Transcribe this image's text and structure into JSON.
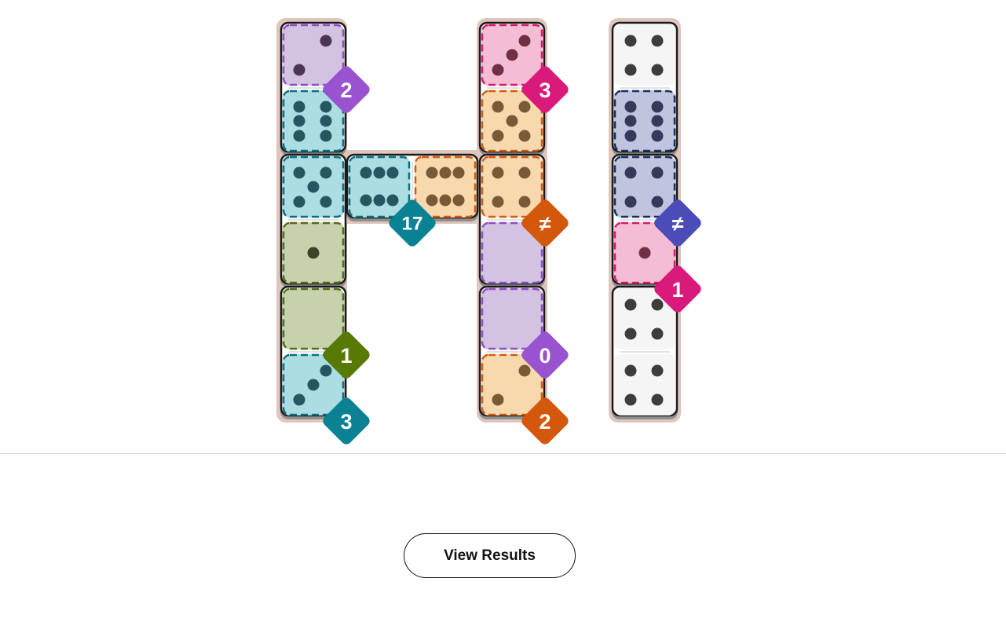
{
  "colors": {
    "tray": "#dfc6bc",
    "domino_border": "#1a1a1a",
    "purple_fill": "#d4c2e2",
    "purple_edge": "#8e4ec4",
    "purple_pip": "#4c3454",
    "purple_badge": "#9a53d0",
    "teal_fill": "#abdde3",
    "teal_edge": "#0d6f80",
    "teal_pip": "#26565f",
    "teal_badge": "#0b8294",
    "orange_fill": "#f7d9ad",
    "orange_edge": "#d35a12",
    "orange_pip": "#7a5a36",
    "orange_badge": "#d4580c",
    "green_fill": "#c6d2ac",
    "green_edge": "#556c18",
    "green_pip": "#3c4427",
    "green_badge": "#577a05",
    "pink_fill": "#f5bdd3",
    "pink_edge": "#d81a6b",
    "pink_pip": "#6f2f45",
    "pink_badge": "#d91a7b",
    "navy_fill": "#c0c4df",
    "navy_edge": "#19305e",
    "navy_pip": "#36395a",
    "navy_badge": "#4b4cb8",
    "white_fill": "#f5f5f5",
    "white_pip": "#3d3d3d"
  },
  "board": {
    "dominoes": [
      {
        "name": "domino-1",
        "orientation": "vertical",
        "pips": [
          2,
          6
        ]
      },
      {
        "name": "domino-2",
        "orientation": "vertical",
        "pips": [
          5,
          1
        ]
      },
      {
        "name": "domino-3",
        "orientation": "vertical",
        "pips": [
          0,
          3
        ]
      },
      {
        "name": "domino-4",
        "orientation": "horizontal",
        "pips": [
          6,
          6
        ]
      },
      {
        "name": "domino-5",
        "orientation": "vertical",
        "pips": [
          3,
          5
        ]
      },
      {
        "name": "domino-6",
        "orientation": "vertical",
        "pips": [
          4,
          0
        ]
      },
      {
        "name": "domino-7",
        "orientation": "vertical",
        "pips": [
          0,
          2
        ]
      },
      {
        "name": "domino-8",
        "orientation": "vertical",
        "pips": [
          4,
          6
        ]
      },
      {
        "name": "domino-9",
        "orientation": "vertical",
        "pips": [
          4,
          1
        ]
      },
      {
        "name": "domino-10",
        "orientation": "vertical",
        "pips": [
          4,
          4
        ]
      }
    ],
    "regions": [
      {
        "color": "purple",
        "label": "2"
      },
      {
        "color": "teal",
        "label": "17"
      },
      {
        "color": "green",
        "label": "1"
      },
      {
        "color": "teal",
        "label": "3"
      },
      {
        "color": "pink",
        "label": "3"
      },
      {
        "color": "orange",
        "label": "≠"
      },
      {
        "color": "purple",
        "label": "0"
      },
      {
        "color": "orange",
        "label": "2"
      },
      {
        "color": "navy",
        "label": "≠"
      },
      {
        "color": "pink",
        "label": "1"
      }
    ]
  },
  "footer": {
    "view_results_label": "View Results"
  }
}
